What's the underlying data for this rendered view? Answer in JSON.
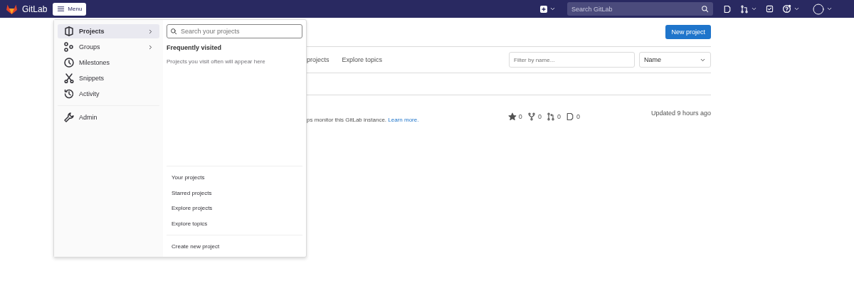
{
  "header": {
    "brand": "GitLab",
    "menu_button": "Menu",
    "search": {
      "placeholder": "Search GitLab"
    }
  },
  "page": {
    "new_project_button": "New project",
    "tabs": [
      "projects",
      "Explore topics"
    ],
    "filter": {
      "placeholder": "Filter by name..."
    },
    "sort": {
      "value": "Name"
    },
    "project": {
      "description": "ps monitor this GitLab instance.",
      "link": "Learn more.",
      "stats": [
        {
          "kind": "star",
          "count": "0"
        },
        {
          "kind": "fork",
          "count": "0"
        },
        {
          "kind": "merge",
          "count": "0"
        },
        {
          "kind": "issue",
          "count": "0"
        }
      ],
      "updated": "Updated 9 hours ago"
    }
  },
  "menu": {
    "items": [
      {
        "label": "Projects",
        "kind": "projects",
        "selected": true,
        "has_submenu": true
      },
      {
        "label": "Groups",
        "kind": "groups",
        "selected": false,
        "has_submenu": true
      },
      {
        "label": "Milestones",
        "kind": "milestones",
        "selected": false,
        "has_submenu": false
      },
      {
        "label": "Snippets",
        "kind": "snippets",
        "selected": false,
        "has_submenu": false
      },
      {
        "label": "Activity",
        "kind": "activity",
        "selected": false,
        "has_submenu": false
      }
    ],
    "admin": {
      "label": "Admin",
      "kind": "admin"
    },
    "search": {
      "placeholder": "Search your projects"
    },
    "frequent_title": "Frequently visited",
    "frequent_empty": "Projects you visit often will appear here",
    "links": [
      "Your projects",
      "Starred projects",
      "Explore projects",
      "Explore topics"
    ],
    "create": "Create new project"
  }
}
